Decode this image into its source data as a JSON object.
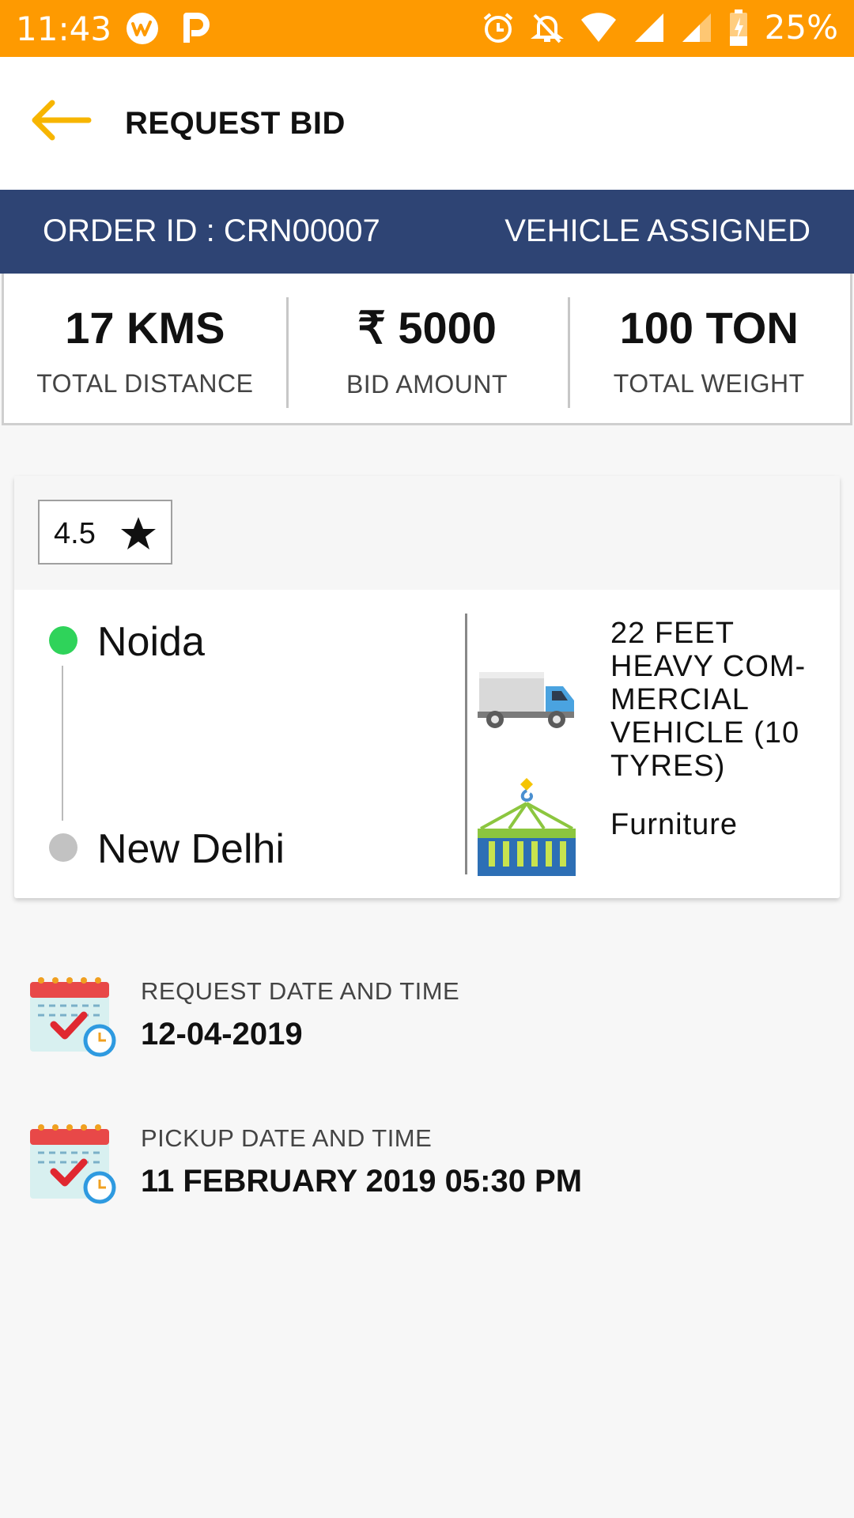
{
  "status_bar": {
    "time": "11:43",
    "battery": "25%",
    "icons": [
      "app-w-icon",
      "app-p-icon",
      "alarm-icon",
      "bell-off-icon",
      "wifi-icon",
      "signal-icon",
      "signal-weak-icon",
      "battery-charging-icon"
    ]
  },
  "header": {
    "title": "REQUEST BID",
    "back_icon": "arrow-left-icon",
    "accent": "#F7B500"
  },
  "order": {
    "id_text": "ORDER ID : CRN00007",
    "status": "VEHICLE ASSIGNED",
    "banner_color": "#2E4474"
  },
  "stats": [
    {
      "value": "17 KMS",
      "label": "TOTAL DISTANCE"
    },
    {
      "value": "₹ 5000",
      "label": "BID AMOUNT"
    },
    {
      "value": "100 TON",
      "label": "TOTAL WEIGHT"
    }
  ],
  "card": {
    "rating": "4.5",
    "rating_icon": "star-icon",
    "from": "Noida",
    "to": "New Delhi",
    "from_color": "#2FD35A",
    "to_color": "#C2C2C2",
    "vehicle_icon": "truck-icon",
    "vehicle_lines": [
      "22 FEET",
      "HEAVY COM-",
      "MERCIAL",
      "VEHICLE (10",
      "TYRES)"
    ],
    "goods_icon": "cargo-container-icon",
    "goods": "Furniture"
  },
  "dates": [
    {
      "label": "REQUEST DATE AND TIME",
      "value": "12-04-2019",
      "icon": "calendar-clock-icon"
    },
    {
      "label": "PICKUP DATE AND TIME",
      "value": "11 FEBRUARY 2019 05:30 PM",
      "icon": "calendar-clock-icon"
    }
  ]
}
